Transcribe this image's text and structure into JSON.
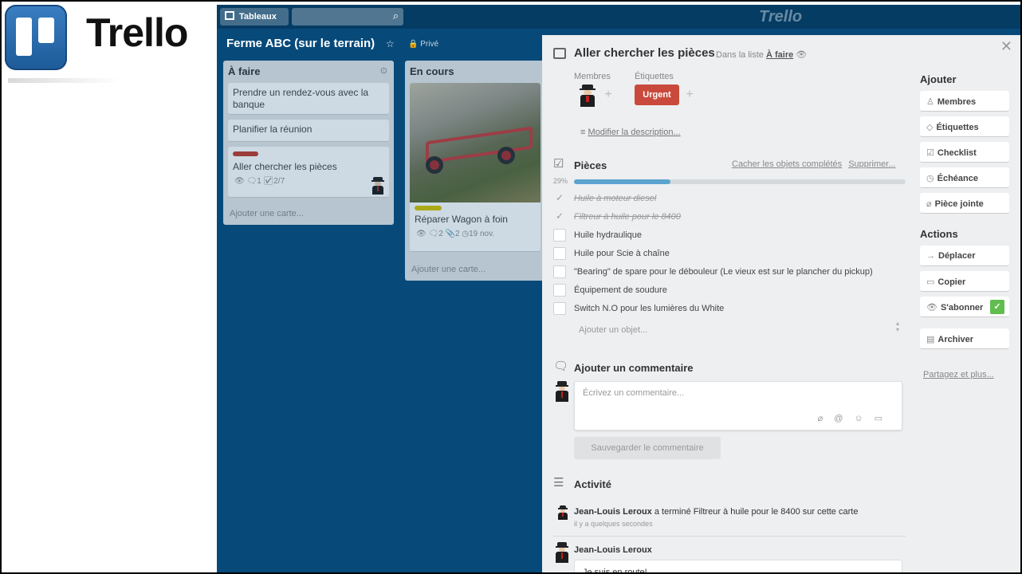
{
  "logo": {
    "text": "Trello"
  },
  "topbar": {
    "boards_label": "Tableaux",
    "brand": "Trello"
  },
  "board": {
    "title": "Ferme ABC (sur le terrain)",
    "visibility": "Privé"
  },
  "lists": [
    {
      "title": "À faire",
      "cards": [
        {
          "title": "Prendre un rendez-vous avec la banque"
        },
        {
          "title": "Planifier la réunion"
        },
        {
          "title": "Aller chercher les pièces",
          "badges": {
            "comments": "1",
            "checklist": "2/7"
          }
        }
      ],
      "add_label": "Ajouter une carte..."
    },
    {
      "title": "En cours",
      "cards": [
        {
          "title": "Réparer Wagon à foin",
          "badges": {
            "comments": "2",
            "attachments": "2",
            "due": "19 nov."
          }
        }
      ],
      "add_label": "Ajouter une carte..."
    }
  ],
  "modal": {
    "title": "Aller chercher les pièces",
    "in_list_prefix": "Dans la liste",
    "in_list_name": "À faire",
    "members_label": "Membres",
    "labels_label": "Étiquettes",
    "label_urgent": "Urgent",
    "description_link": "Modifier la description...",
    "checklist": {
      "title": "Pièces",
      "hide_completed": "Cacher les objets complétés",
      "delete": "Supprimer...",
      "progress_pct": "29%",
      "progress_value": 29,
      "items": [
        {
          "text": "Huile à moteur diesel",
          "done": true
        },
        {
          "text": "Filtreur à huile pour le 8400",
          "done": true
        },
        {
          "text": "Huile hydraulique",
          "done": false
        },
        {
          "text": "Huile pour Scie à chaîne",
          "done": false
        },
        {
          "text": "\"Bearing\" de spare pour le débouleur (Le vieux est sur le plancher du pickup)",
          "done": false
        },
        {
          "text": "Équipement de soudure",
          "done": false
        },
        {
          "text": "Switch N.O pour les lumières du White",
          "done": false
        }
      ],
      "add_item_placeholder": "Ajouter un objet..."
    },
    "comment": {
      "title": "Ajouter un commentaire",
      "placeholder": "Écrivez un commentaire...",
      "save_label": "Sauvegarder le commentaire"
    },
    "activity": {
      "title": "Activité",
      "entries": [
        {
          "user": "Jean-Louis Leroux",
          "action": "a terminé Filtreur à huile pour le 8400 sur cette carte",
          "time": "il y a quelques secondes"
        },
        {
          "user": "Jean-Louis Leroux",
          "comment": "Je suis en route!"
        }
      ]
    },
    "sidebar": {
      "add_title": "Ajouter",
      "add_buttons": [
        "Membres",
        "Étiquettes",
        "Checklist",
        "Échéance",
        "Pièce jointe"
      ],
      "actions_title": "Actions",
      "action_buttons": [
        "Déplacer",
        "Copier",
        "S'abonner",
        "Archiver"
      ],
      "share_link": "Partagez et plus..."
    }
  },
  "colors": {
    "board_bg": "#074a7a",
    "urgent": "#c94a3c",
    "progress": "#5ba4cf",
    "subscribe_check": "#61bd4f"
  }
}
